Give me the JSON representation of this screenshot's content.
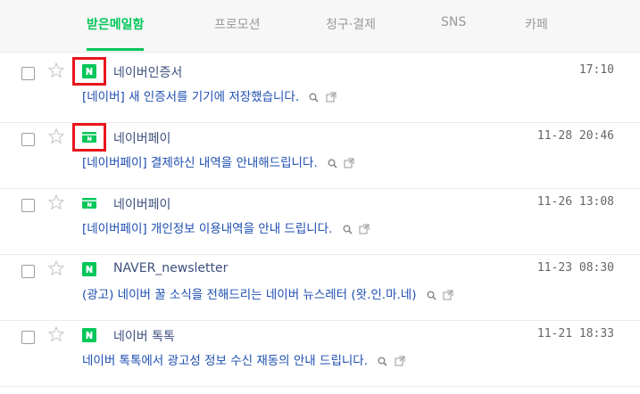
{
  "tabs": [
    {
      "label": "받은메일함",
      "active": true
    },
    {
      "label": "프로모션",
      "active": false
    },
    {
      "label": "청구·결제",
      "active": false
    },
    {
      "label": "SNS",
      "active": false
    },
    {
      "label": "카페",
      "active": false
    }
  ],
  "colors": {
    "accent": "#03c75a",
    "highlight": "#e8161d",
    "subject": "#1e4eb0"
  },
  "mails": [
    {
      "icon": "naver-n-icon",
      "sender": "네이버인증서",
      "time": "17:10",
      "subject": "[네이버] 새 인증서를 기기에 저장했습니다."
    },
    {
      "icon": "naver-pay-icon",
      "sender": "네이버페이",
      "time": "11-28 20:46",
      "subject": "[네이버페이] 결제하신 내역을 안내해드립니다."
    },
    {
      "icon": "naver-pay-icon",
      "sender": "네이버페이",
      "time": "11-26 13:08",
      "subject": "[네이버페이] 개인정보 이용내역을 안내 드립니다."
    },
    {
      "icon": "naver-n-icon",
      "sender": "NAVER_newsletter",
      "time": "11-23 08:30",
      "subject": "(광고) 네이버 꿀 소식을 전해드리는 네이버 뉴스레터 (왓.인.마.네)"
    },
    {
      "icon": "naver-n-icon",
      "sender": "네이버 톡톡",
      "time": "11-21 18:33",
      "subject": "네이버 톡톡에서 광고성 정보 수신 재동의 안내 드립니다."
    }
  ]
}
